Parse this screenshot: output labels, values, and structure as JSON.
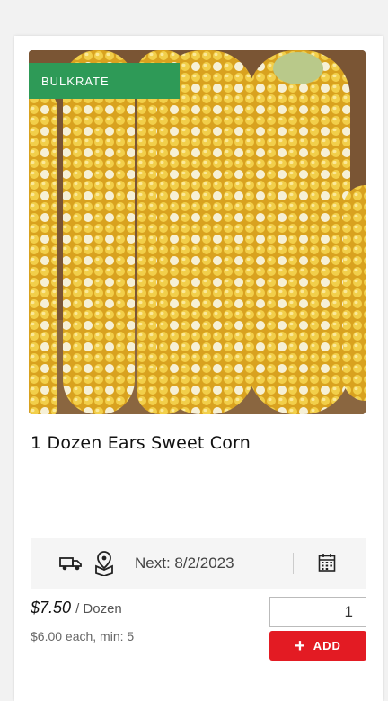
{
  "product": {
    "badge": "BULKRATE",
    "title": "1 Dozen Ears Sweet Corn",
    "image_alt": "sweet-corn-photo"
  },
  "delivery": {
    "next_label": "Next: 8/2/2023",
    "truck_icon": "truck-icon",
    "pickup_icon": "pickup-location-icon",
    "calendar_icon": "calendar-icon"
  },
  "pricing": {
    "price": "$7.50",
    "unit": "/ Dozen",
    "each_text": "$6.00 each, min: 5"
  },
  "cart": {
    "quantity": "1",
    "add_label": "ADD"
  },
  "colors": {
    "badge_green": "#2e9a57",
    "add_red": "#e31b23"
  }
}
